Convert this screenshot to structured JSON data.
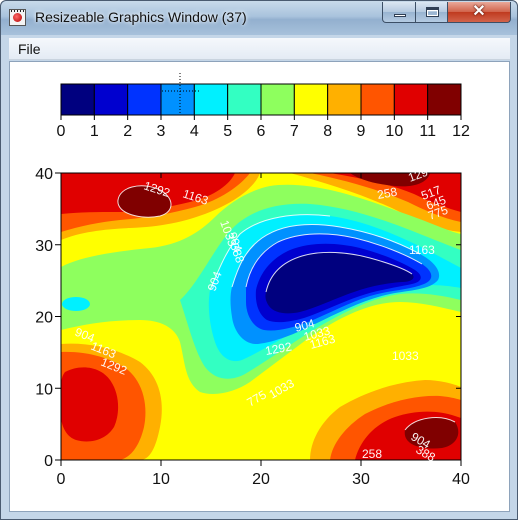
{
  "window": {
    "title": "Resizeable Graphics Window (37)",
    "icon": "app-window-icon",
    "controls": {
      "minimize": "minimize-icon",
      "maximize": "maximize-icon",
      "close": "close-icon",
      "close_glyph": "✕"
    }
  },
  "menu": {
    "file_label": "File"
  },
  "colorbar": {
    "ticks": [
      "0",
      "1",
      "2",
      "3",
      "4",
      "5",
      "6",
      "7",
      "8",
      "9",
      "10",
      "11",
      "12"
    ],
    "colors": [
      "#00007f",
      "#0000cf",
      "#0033ff",
      "#0091ff",
      "#00f0ff",
      "#33ffc2",
      "#8eff5e",
      "#ffff00",
      "#ffb000",
      "#ff5500",
      "#e00000",
      "#800000"
    ]
  },
  "chart_data": {
    "type": "heatmap",
    "subtype": "filled-contour",
    "x_ticks": [
      "0",
      "10",
      "20",
      "30",
      "40"
    ],
    "y_ticks": [
      "0",
      "10",
      "20",
      "30",
      "40"
    ],
    "xlim": [
      0,
      40
    ],
    "ylim": [
      0,
      40
    ],
    "contour_labels": [
      "1292",
      "1163",
      "1033",
      "904",
      "388",
      "258",
      "129",
      "517",
      "645",
      "775",
      "1163",
      "904",
      "1033",
      "1163",
      "1292",
      "904",
      "775",
      "1033",
      "904",
      "1163",
      "1292",
      "1033",
      "904",
      "388",
      "258"
    ]
  }
}
